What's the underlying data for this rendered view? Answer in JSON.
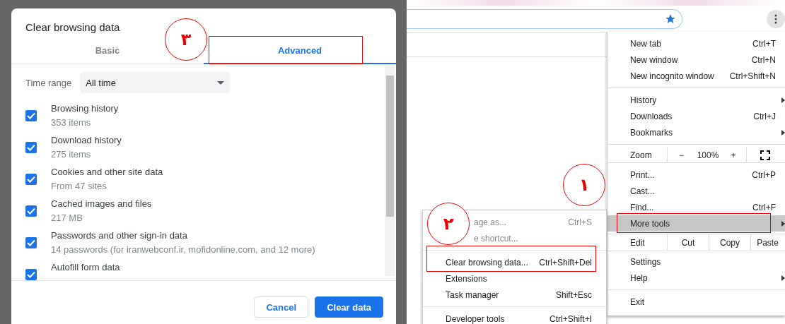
{
  "dialog": {
    "title": "Clear browsing data",
    "tabs": [
      {
        "label": "Basic",
        "selected": false
      },
      {
        "label": "Advanced",
        "selected": true
      }
    ],
    "time_range": {
      "label": "Time range",
      "value": "All time"
    },
    "options": [
      {
        "label": "Browsing history",
        "detail": "353 items",
        "checked": true
      },
      {
        "label": "Download history",
        "detail": "275 items",
        "checked": true
      },
      {
        "label": "Cookies and other site data",
        "detail": "From 47 sites",
        "checked": true
      },
      {
        "label": "Cached images and files",
        "detail": "217 MB",
        "checked": true
      },
      {
        "label": "Passwords and other sign-in data",
        "detail": "14 passwords (for iranwebconf.ir, mofidonline.com, and 12 more)",
        "checked": true
      },
      {
        "label": "Autofill form data",
        "checked": true
      }
    ],
    "buttons": [
      {
        "label": "Cancel",
        "kind": "secondary"
      },
      {
        "label": "Clear data",
        "kind": "primary"
      }
    ]
  },
  "menu": {
    "items": [
      {
        "kind": "item",
        "label": "New tab",
        "shortcut": "Ctrl+T",
        "submenu": false,
        "highlighted": false
      },
      {
        "kind": "item",
        "label": "New window",
        "shortcut": "Ctrl+N",
        "submenu": false,
        "highlighted": false
      },
      {
        "kind": "item",
        "label": "New incognito window",
        "shortcut": "Ctrl+Shift+N",
        "submenu": false,
        "highlighted": false
      },
      {
        "kind": "separator"
      },
      {
        "kind": "item",
        "label": "History",
        "submenu": true,
        "highlighted": false
      },
      {
        "kind": "item",
        "label": "Downloads",
        "shortcut": "Ctrl+J",
        "submenu": false,
        "highlighted": false
      },
      {
        "kind": "item",
        "label": "Bookmarks",
        "submenu": true,
        "highlighted": false
      },
      {
        "kind": "separator"
      },
      {
        "kind": "zoom",
        "label": "Zoom",
        "minus": "−",
        "value": "100%",
        "plus": "+"
      },
      {
        "kind": "separator"
      },
      {
        "kind": "item",
        "label": "Print...",
        "shortcut": "Ctrl+P",
        "submenu": false,
        "highlighted": false
      },
      {
        "kind": "item",
        "label": "Cast...",
        "submenu": false,
        "highlighted": false
      },
      {
        "kind": "item",
        "label": "Find...",
        "shortcut": "Ctrl+F",
        "submenu": false,
        "highlighted": false
      },
      {
        "kind": "item",
        "label": "More tools",
        "submenu": true,
        "highlighted": true
      },
      {
        "kind": "edit",
        "label": "Edit",
        "actions": [
          "Cut",
          "Copy",
          "Paste"
        ]
      },
      {
        "kind": "item",
        "label": "Settings",
        "submenu": false,
        "highlighted": false
      },
      {
        "kind": "item",
        "label": "Help",
        "submenu": true,
        "highlighted": false
      },
      {
        "kind": "separator"
      },
      {
        "kind": "item",
        "label": "Exit",
        "submenu": false,
        "highlighted": false
      }
    ]
  },
  "submenu": {
    "items": [
      {
        "kind": "covered",
        "label": "age as...",
        "shortcut": "Ctrl+S"
      },
      {
        "kind": "covered",
        "label": "e shortcut..."
      },
      {
        "kind": "separator"
      },
      {
        "kind": "item",
        "label": "Clear browsing data...",
        "shortcut": "Ctrl+Shift+Del"
      },
      {
        "kind": "item",
        "label": "Extensions"
      },
      {
        "kind": "item",
        "label": "Task manager",
        "shortcut": "Shift+Esc"
      },
      {
        "kind": "separator"
      },
      {
        "kind": "item",
        "label": "Developer tools",
        "shortcut": "Ctrl+Shift+I"
      }
    ]
  },
  "annotations": [
    {
      "number": "۱"
    },
    {
      "number": "۲"
    },
    {
      "number": "۳"
    }
  ]
}
